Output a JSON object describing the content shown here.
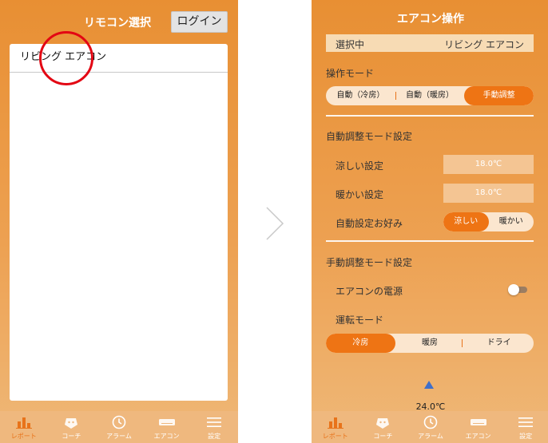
{
  "left": {
    "title": "リモコン選択",
    "login_label": "ログイン",
    "remotes": [
      {
        "name": "リビング エアコン"
      }
    ]
  },
  "right": {
    "title": "エアコン操作",
    "selected_key": "選択中",
    "selected_value": "リビング エアコン",
    "mode_label": "操作モード",
    "modes": [
      "自動（冷房）",
      "自動（暖房）",
      "手動調整"
    ],
    "auto_section_label": "自動調整モード設定",
    "cool_setting_label": "涼しい設定",
    "cool_setting_value": "18.0℃",
    "warm_setting_label": "暖かい設定",
    "warm_setting_value": "18.0℃",
    "preference_label": "自動設定お好み",
    "preferences": [
      "涼しい",
      "暖かい"
    ],
    "manual_section_label": "手動調整モード設定",
    "power_label": "エアコンの電源",
    "run_mode_label": "運転モード",
    "run_modes": [
      "冷房",
      "暖房",
      "ドライ"
    ],
    "set_temp": "24.0℃"
  },
  "tabs": [
    {
      "label": "レポート",
      "icon": "report-bar-chart-icon"
    },
    {
      "label": "コーチ",
      "icon": "coach-face-icon"
    },
    {
      "label": "アラーム",
      "icon": "alarm-clock-icon"
    },
    {
      "label": "エアコン",
      "icon": "air-conditioner-icon"
    },
    {
      "label": "設定",
      "icon": "settings-menu-icon"
    }
  ],
  "colors": {
    "accent": "#ee7414",
    "background_top": "#e88f33",
    "highlight_circle": "#e30613",
    "arrow": "#3f6fc9"
  }
}
